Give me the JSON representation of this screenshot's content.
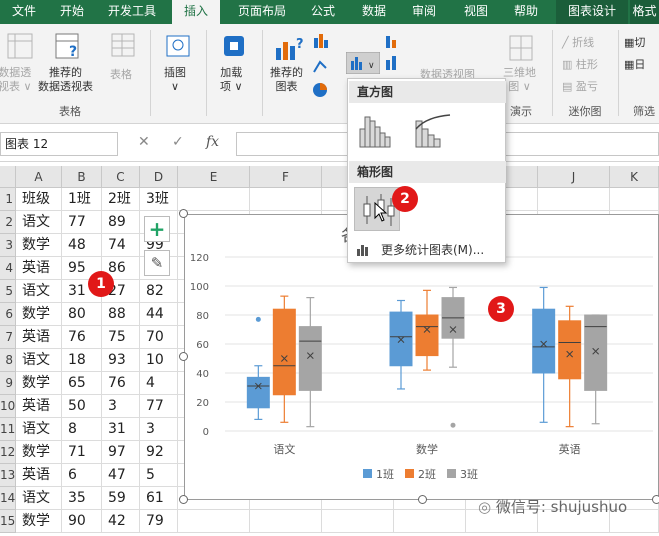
{
  "ribbon_tabs": [
    "文件",
    "开始",
    "开发工具",
    "插入",
    "页面布局",
    "公式",
    "数据",
    "审阅",
    "视图",
    "帮助",
    "图表设计",
    "格式"
  ],
  "active_tab": "插入",
  "ribbon": {
    "pivot_label": "数据透\n视表 ∨",
    "recommended_pivot_label": "推荐的\n数据透视表",
    "table_label": "表格",
    "group_table": "表格",
    "illustrations_label": "插图\n∨",
    "addins_label": "加载\n项 ∨",
    "recommended_charts_label": "推荐的\n图表",
    "pivot_chart_label": "数据透视图",
    "map3d_label": "三维地\n图 ∨",
    "group_demo": "演示",
    "spark_line": "折线",
    "spark_column": "柱形",
    "spark_winloss": "盈亏",
    "group_sparkline": "迷你图",
    "slicer_label": "切",
    "timeline_label": "日",
    "group_filter": "筛选"
  },
  "formula_bar": {
    "name_box": "图表 12",
    "cancel": "✕",
    "enter": "✓",
    "fx": "fx"
  },
  "columns": [
    "A",
    "B",
    "C",
    "D",
    "E",
    "F",
    "G",
    "H",
    "I",
    "J",
    "K"
  ],
  "rows": [
    {
      "n": "1",
      "a": "班级",
      "b": "1班",
      "c": "2班",
      "d": "3班"
    },
    {
      "n": "2",
      "a": "语文",
      "b": "77",
      "c": "89",
      "d": ""
    },
    {
      "n": "3",
      "a": "数学",
      "b": "48",
      "c": "74",
      "d": "99"
    },
    {
      "n": "4",
      "a": "英语",
      "b": "95",
      "c": "86",
      "d": ""
    },
    {
      "n": "5",
      "a": "语文",
      "b": "31",
      "c": "27",
      "d": "82"
    },
    {
      "n": "6",
      "a": "数学",
      "b": "80",
      "c": "88",
      "d": "44"
    },
    {
      "n": "7",
      "a": "英语",
      "b": "76",
      "c": "75",
      "d": "70"
    },
    {
      "n": "8",
      "a": "语文",
      "b": "18",
      "c": "93",
      "d": "10"
    },
    {
      "n": "9",
      "a": "数学",
      "b": "65",
      "c": "76",
      "d": "4"
    },
    {
      "n": "10",
      "a": "英语",
      "b": "50",
      "c": "3",
      "d": "77"
    },
    {
      "n": "11",
      "a": "语文",
      "b": "8",
      "c": "31",
      "d": "3"
    },
    {
      "n": "12",
      "a": "数学",
      "b": "71",
      "c": "97",
      "d": "92"
    },
    {
      "n": "13",
      "a": "英语",
      "b": "6",
      "c": "47",
      "d": "5"
    },
    {
      "n": "14",
      "a": "语文",
      "b": "35",
      "c": "59",
      "d": "61"
    },
    {
      "n": "15",
      "a": "数学",
      "b": "90",
      "c": "42",
      "d": "79"
    }
  ],
  "dropdown": {
    "histogram_header": "直方图",
    "boxplot_header": "箱形图",
    "more_label": "更多统计图表(M)..."
  },
  "side_buttons": {
    "add": "+",
    "style": "✎"
  },
  "markers": [
    "1",
    "2",
    "3"
  ],
  "colors": {
    "ribbon_green": "#217346",
    "series1": "#5B9BD5",
    "series2": "#ED7D31",
    "series3": "#A5A5A5",
    "marker_red": "#E11818"
  },
  "watermark": "微信号: shujushuo",
  "chart_data": {
    "type": "box",
    "title_partial": "各",
    "categories": [
      "语文",
      "数学",
      "英语"
    ],
    "ylim": [
      0,
      120
    ],
    "yticks": [
      "0",
      "20",
      "40",
      "60",
      "80",
      "100",
      "120"
    ],
    "legend": "bottom",
    "series": [
      {
        "name": "1班",
        "color": "#5B9BD5",
        "boxes": [
          {
            "min": 8,
            "q1": 16,
            "median": 31,
            "q3": 37,
            "max": 45,
            "mean": 31,
            "outliers": [
              77
            ]
          },
          {
            "min": 29,
            "q1": 45,
            "median": 65,
            "q3": 82,
            "max": 90,
            "mean": 63,
            "outliers": []
          },
          {
            "min": 6,
            "q1": 40,
            "median": 58,
            "q3": 84,
            "max": 99,
            "mean": 60,
            "outliers": []
          }
        ]
      },
      {
        "name": "2班",
        "color": "#ED7D31",
        "boxes": [
          {
            "min": 6,
            "q1": 25,
            "median": 45,
            "q3": 84,
            "max": 93,
            "mean": 50,
            "outliers": []
          },
          {
            "min": 42,
            "q1": 52,
            "median": 72,
            "q3": 80,
            "max": 97,
            "mean": 70,
            "outliers": []
          },
          {
            "min": 3,
            "q1": 36,
            "median": 61,
            "q3": 76,
            "max": 86,
            "mean": 53,
            "outliers": []
          }
        ]
      },
      {
        "name": "3班",
        "color": "#A5A5A5",
        "boxes": [
          {
            "min": 3,
            "q1": 28,
            "median": 62,
            "q3": 72,
            "max": 92,
            "mean": 52,
            "outliers": []
          },
          {
            "min": 44,
            "q1": 64,
            "median": 78,
            "q3": 92,
            "max": 99,
            "mean": 70,
            "outliers": [
              4
            ]
          },
          {
            "min": 5,
            "q1": 28,
            "median": 72,
            "q3": 80,
            "max": 80,
            "mean": 55,
            "outliers": []
          }
        ]
      }
    ]
  }
}
